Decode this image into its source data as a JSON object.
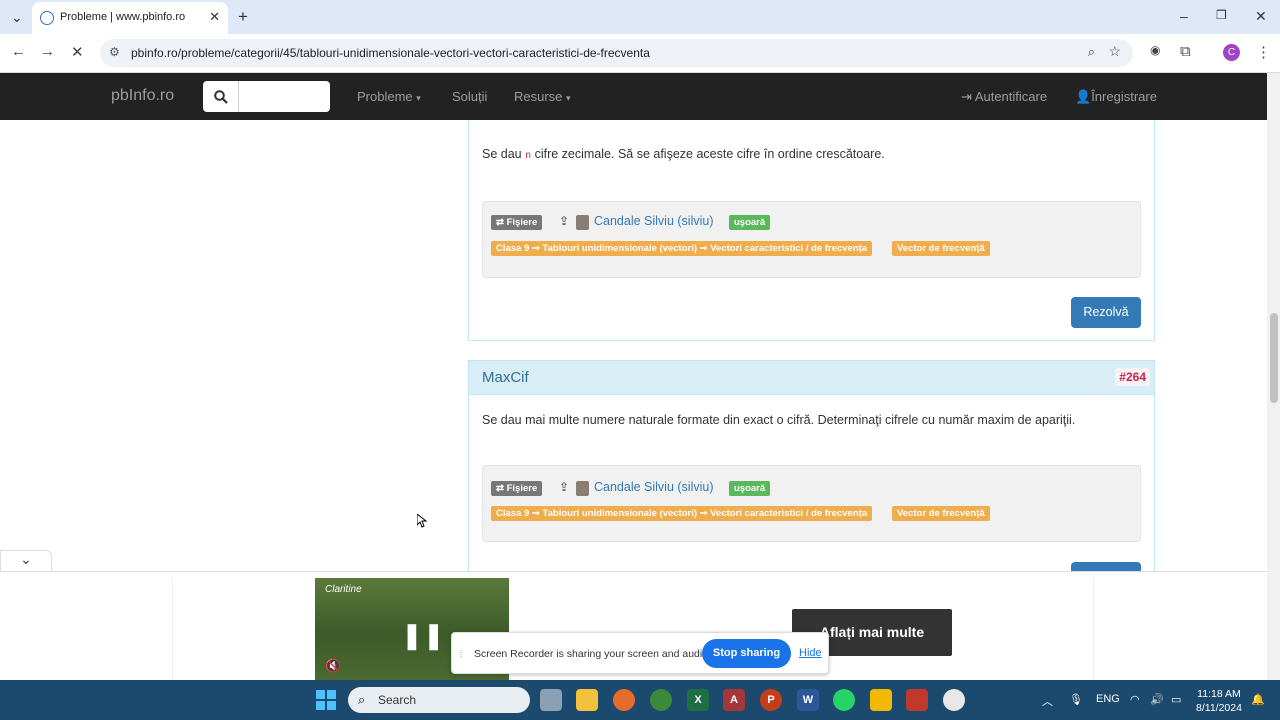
{
  "browser": {
    "tab_title": "Probleme | www.pbinfo.ro",
    "url": "pbinfo.ro/probleme/categorii/45/tablouri-unidimensionale-vectori-vectori-caracteristici-de-frecventa",
    "profile_initial": "C"
  },
  "site": {
    "brand": "pbInfo.ro",
    "nav": [
      "Probleme",
      "Soluții",
      "Resurse"
    ],
    "login": "Autentificare",
    "register": "Înregistrare"
  },
  "problems": [
    {
      "desc_pre": "Se dau ",
      "desc_code": "n",
      "desc_post": " cifre zecimale. Să se afişeze aceste cifre în ordine crescătoare.",
      "files_label": "⇄ Fişiere",
      "author": "Candale Silviu (silviu)",
      "difficulty": "uşoară",
      "category": "Clasa 9 ➞ Tablouri unidimensionale (vectori) ➞ Vectori caracteristici / de frecvența",
      "tag": "Vector de frecvență",
      "solve": "Rezolvă"
    },
    {
      "title": "MaxCif",
      "id": "#264",
      "desc": "Se dau mai multe numere naturale formate din exact o cifră. Determinaţi cifrele cu număr maxim de apariţii.",
      "files_label": "⇄ Fişiere",
      "author": "Candale Silviu (silviu)",
      "difficulty": "uşoară",
      "category": "Clasa 9 ➞ Tablouri unidimensionale (vectori) ➞ Vectori caracteristici / de frecvența",
      "tag": "Vector de frecvență"
    }
  ],
  "ad": {
    "brand": "Claritine",
    "cta": "Aflați mai multe"
  },
  "share": {
    "message": "Screen Recorder is sharing your screen and audio.",
    "stop": "Stop sharing",
    "hide": "Hide"
  },
  "taskbar": {
    "search": "Search",
    "lang": "ENG",
    "time": "11:18 AM",
    "date": "8/11/2024"
  }
}
